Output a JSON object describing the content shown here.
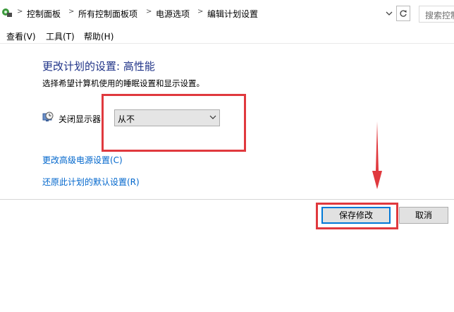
{
  "address_bar": {
    "breadcrumbs": [
      "控制面板",
      "所有控制面板项",
      "电源选项",
      "编辑计划设置"
    ],
    "search_placeholder": "搜索控制面板"
  },
  "menu": {
    "items": [
      "查看(V)",
      "工具(T)",
      "帮助(H)"
    ]
  },
  "content": {
    "title": "更改计划的设置: 高性能",
    "subtitle": "选择希望计算机使用的睡眠设置和显示设置。",
    "display_off_label": "关闭显示器",
    "display_off_value": "从不",
    "advanced_link": "更改高级电源设置(C)",
    "restore_link": "还原此计划的默认设置(R)"
  },
  "buttons": {
    "save": "保存修改",
    "cancel": "取消"
  },
  "colors": {
    "annotation_red": "#e0393e",
    "title_blue": "#1e3287",
    "link_blue": "#0066cc"
  },
  "icons": [
    "control-panel-icon",
    "monitor-clock-icon",
    "chevron-down-icon",
    "refresh-icon"
  ]
}
